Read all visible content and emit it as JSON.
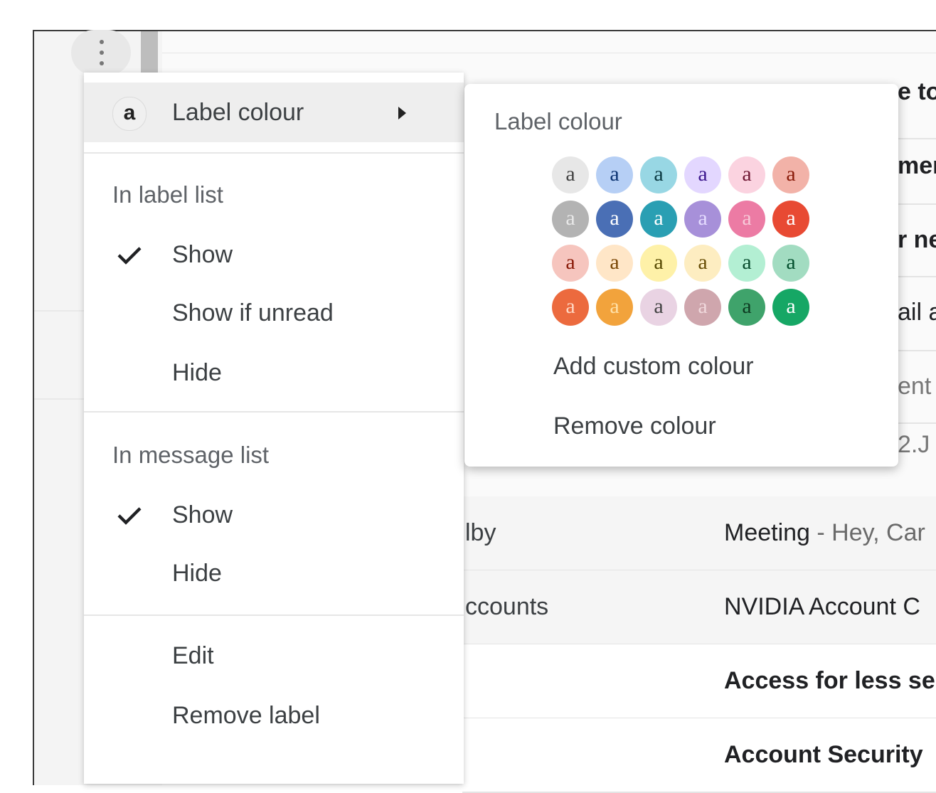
{
  "menu": {
    "label_colour": {
      "chip": "a",
      "label": "Label colour"
    },
    "in_label_list": {
      "heading": "In label list",
      "options": [
        {
          "label": "Show",
          "checked": true
        },
        {
          "label": "Show if unread",
          "checked": false
        },
        {
          "label": "Hide",
          "checked": false
        }
      ]
    },
    "in_message_list": {
      "heading": "In message list",
      "options": [
        {
          "label": "Show",
          "checked": true
        },
        {
          "label": "Hide",
          "checked": false
        }
      ]
    },
    "actions": {
      "edit": "Edit",
      "remove": "Remove label"
    }
  },
  "submenu": {
    "title": "Label colour",
    "swatch_letter": "a",
    "swatches": [
      [
        {
          "bg": "#e7e7e7",
          "fg": "#444444"
        },
        {
          "bg": "#b6cff5",
          "fg": "#0d3472"
        },
        {
          "bg": "#98d7e4",
          "fg": "#0d3b44"
        },
        {
          "bg": "#e3d7ff",
          "fg": "#3d188e"
        },
        {
          "bg": "#fbd3e0",
          "fg": "#711a36"
        },
        {
          "bg": "#f2b2a8",
          "fg": "#8a1c0a"
        }
      ],
      [
        {
          "bg": "#b3b3b3",
          "fg": "#e8e8e8"
        },
        {
          "bg": "#4a6fb5",
          "fg": "#ffffff"
        },
        {
          "bg": "#2a9fb3",
          "fg": "#ffffff"
        },
        {
          "bg": "#a790d9",
          "fg": "#e5dcff"
        },
        {
          "bg": "#ec7ba4",
          "fg": "#f7c9d8"
        },
        {
          "bg": "#e84a33",
          "fg": "#ffffff"
        }
      ],
      [
        {
          "bg": "#f6c5be",
          "fg": "#8a1c0a"
        },
        {
          "bg": "#ffe6c7",
          "fg": "#7a4706"
        },
        {
          "bg": "#fef1a8",
          "fg": "#594c05"
        },
        {
          "bg": "#fdedc1",
          "fg": "#684e07"
        },
        {
          "bg": "#b3efd3",
          "fg": "#0b4f30"
        },
        {
          "bg": "#a2dcc1",
          "fg": "#04502e"
        }
      ],
      [
        {
          "bg": "#ec6a3e",
          "fg": "#ffd6c2"
        },
        {
          "bg": "#f2a33c",
          "fg": "#ffe1a8"
        },
        {
          "bg": "#e9d3e3",
          "fg": "#444444"
        },
        {
          "bg": "#cfa6ad",
          "fg": "#f0d8dc"
        },
        {
          "bg": "#3fa36b",
          "fg": "#0e3b22"
        },
        {
          "bg": "#16a765",
          "fg": "#ffffff"
        }
      ]
    ],
    "add_custom": "Add custom colour",
    "remove_colour": "Remove colour"
  },
  "background": {
    "fragments": [
      "e to",
      "men",
      "r ne",
      "ail a",
      "ent",
      "2.J"
    ],
    "rows": [
      {
        "sender": "lby",
        "subject": "Meeting",
        "snippet": " - Hey, Car"
      },
      {
        "sender": "ccounts",
        "subject": "NVIDIA Account C",
        "snippet": ""
      },
      {
        "sender": "",
        "subject": "Access for less se",
        "snippet": ""
      },
      {
        "sender": "",
        "subject": "Account Security",
        "snippet": ""
      }
    ]
  }
}
